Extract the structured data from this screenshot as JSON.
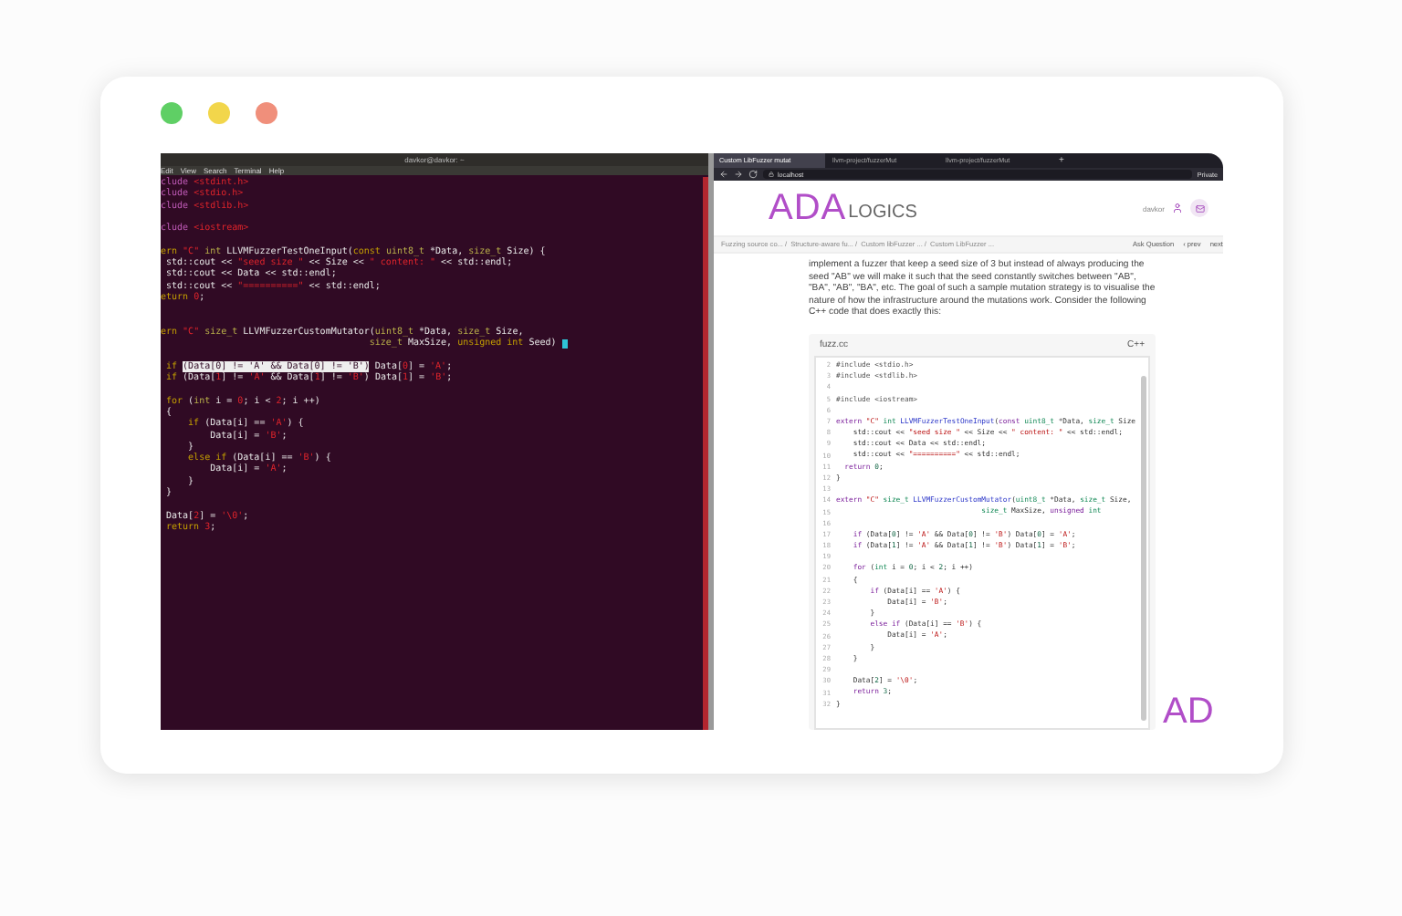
{
  "window_controls": [
    {
      "color": "#5fcf65"
    },
    {
      "color": "#f2d64b"
    },
    {
      "color": "#f08f7b"
    }
  ],
  "terminal": {
    "title": "davkor@davkor: ~",
    "menu": [
      "Edit",
      "View",
      "Search",
      "Terminal",
      "Help"
    ],
    "lines": [
      {
        "kind": "code",
        "segments": [
          {
            "text": "clude ",
            "kind": "preproc"
          },
          {
            "text": "<stdint.h>",
            "kind": "string"
          }
        ]
      },
      {
        "kind": "code",
        "segments": [
          {
            "text": "clude ",
            "kind": "preproc"
          },
          {
            "text": "<stdio.h>",
            "kind": "string"
          }
        ]
      },
      {
        "kind": "code",
        "segments": [
          {
            "text": "clude ",
            "kind": "preproc"
          },
          {
            "text": "<stdlib.h>",
            "kind": "string"
          }
        ]
      },
      {
        "kind": "blank"
      },
      {
        "kind": "code",
        "segments": [
          {
            "text": "clude ",
            "kind": "preproc"
          },
          {
            "text": "<iostream>",
            "kind": "string"
          }
        ]
      },
      {
        "kind": "blank"
      },
      {
        "kind": "code",
        "segments": [
          {
            "text": "ern ",
            "kind": "keyword"
          },
          {
            "text": "\"C\"",
            "kind": "string"
          },
          {
            "text": " int",
            "kind": "type"
          },
          {
            "text": " LLVMFuzzerTestOneInput(",
            "kind": "plain"
          },
          {
            "text": "const ",
            "kind": "keyword"
          },
          {
            "text": "uint8_t",
            "kind": "type"
          },
          {
            "text": " *Data, ",
            "kind": "plain"
          },
          {
            "text": "size_t",
            "kind": "type"
          },
          {
            "text": " Size) {",
            "kind": "plain"
          }
        ]
      },
      {
        "kind": "code",
        "segments": [
          {
            "text": " std::cout << ",
            "kind": "plain"
          },
          {
            "text": "\"seed size \"",
            "kind": "string"
          },
          {
            "text": " << Size << ",
            "kind": "plain"
          },
          {
            "text": "\" content: \"",
            "kind": "string"
          },
          {
            "text": " << std::endl;",
            "kind": "plain"
          }
        ]
      },
      {
        "kind": "code",
        "segments": [
          {
            "text": " std::cout << Data << std::endl;",
            "kind": "plain"
          }
        ]
      },
      {
        "kind": "code",
        "segments": [
          {
            "text": " std::cout << ",
            "kind": "plain"
          },
          {
            "text": "\"==========\"",
            "kind": "string"
          },
          {
            "text": " << std::endl;",
            "kind": "plain"
          }
        ]
      },
      {
        "kind": "code",
        "segments": [
          {
            "text": "eturn ",
            "kind": "keyword"
          },
          {
            "text": "0",
            "kind": "number"
          },
          {
            "text": ";",
            "kind": "plain"
          }
        ]
      },
      {
        "kind": "blank"
      },
      {
        "kind": "blank"
      },
      {
        "kind": "code",
        "segments": [
          {
            "text": "ern ",
            "kind": "keyword"
          },
          {
            "text": "\"C\"",
            "kind": "string"
          },
          {
            "text": " size_t",
            "kind": "type"
          },
          {
            "text": " LLVMFuzzerCustomMutator(",
            "kind": "plain"
          },
          {
            "text": "uint8_t",
            "kind": "type"
          },
          {
            "text": " *Data, ",
            "kind": "plain"
          },
          {
            "text": "size_t",
            "kind": "type"
          },
          {
            "text": " Size,",
            "kind": "plain"
          }
        ]
      },
      {
        "kind": "code",
        "cursor": true,
        "segments": [
          {
            "text": "                                      size_t",
            "kind": "type"
          },
          {
            "text": " MaxSize, ",
            "kind": "plain"
          },
          {
            "text": "unsigned int",
            "kind": "keyword"
          },
          {
            "text": " Seed) ",
            "kind": "plain"
          }
        ]
      },
      {
        "kind": "blank"
      },
      {
        "kind": "code",
        "segments": [
          {
            "text": " if ",
            "kind": "keyword"
          },
          {
            "text": "(Data[0] != 'A' && Data[0] != 'B')",
            "kind": "match"
          },
          {
            "text": " Data[",
            "kind": "plain"
          },
          {
            "text": "0",
            "kind": "number"
          },
          {
            "text": "] = ",
            "kind": "plain"
          },
          {
            "text": "'A'",
            "kind": "string"
          },
          {
            "text": ";",
            "kind": "plain"
          }
        ]
      },
      {
        "kind": "code",
        "segments": [
          {
            "text": " if",
            "kind": "keyword"
          },
          {
            "text": " (Data[",
            "kind": "plain"
          },
          {
            "text": "1",
            "kind": "number"
          },
          {
            "text": "] != ",
            "kind": "plain"
          },
          {
            "text": "'A'",
            "kind": "string"
          },
          {
            "text": " && Data[",
            "kind": "plain"
          },
          {
            "text": "1",
            "kind": "number"
          },
          {
            "text": "] != ",
            "kind": "plain"
          },
          {
            "text": "'B'",
            "kind": "string"
          },
          {
            "text": ") Data[",
            "kind": "plain"
          },
          {
            "text": "1",
            "kind": "number"
          },
          {
            "text": "] = ",
            "kind": "plain"
          },
          {
            "text": "'B'",
            "kind": "string"
          },
          {
            "text": ";",
            "kind": "plain"
          }
        ]
      },
      {
        "kind": "blank"
      },
      {
        "kind": "code",
        "segments": [
          {
            "text": " for",
            "kind": "keyword"
          },
          {
            "text": " (",
            "kind": "plain"
          },
          {
            "text": "int",
            "kind": "type"
          },
          {
            "text": " i = ",
            "kind": "plain"
          },
          {
            "text": "0",
            "kind": "number"
          },
          {
            "text": "; i < ",
            "kind": "plain"
          },
          {
            "text": "2",
            "kind": "number"
          },
          {
            "text": "; i ++)",
            "kind": "plain"
          }
        ]
      },
      {
        "kind": "code",
        "segments": [
          {
            "text": " {",
            "kind": "plain"
          }
        ]
      },
      {
        "kind": "code",
        "segments": [
          {
            "text": "     if",
            "kind": "keyword"
          },
          {
            "text": " (Data[i] == ",
            "kind": "plain"
          },
          {
            "text": "'A'",
            "kind": "string"
          },
          {
            "text": ") {",
            "kind": "plain"
          }
        ]
      },
      {
        "kind": "code",
        "segments": [
          {
            "text": "         Data[i] = ",
            "kind": "plain"
          },
          {
            "text": "'B'",
            "kind": "string"
          },
          {
            "text": ";",
            "kind": "plain"
          }
        ]
      },
      {
        "kind": "code",
        "segments": [
          {
            "text": "     }",
            "kind": "plain"
          }
        ]
      },
      {
        "kind": "code",
        "segments": [
          {
            "text": "     else if",
            "kind": "keyword"
          },
          {
            "text": " (Data[i] == ",
            "kind": "plain"
          },
          {
            "text": "'B'",
            "kind": "string"
          },
          {
            "text": ") {",
            "kind": "plain"
          }
        ]
      },
      {
        "kind": "code",
        "segments": [
          {
            "text": "         Data[i] = ",
            "kind": "plain"
          },
          {
            "text": "'A'",
            "kind": "string"
          },
          {
            "text": ";",
            "kind": "plain"
          }
        ]
      },
      {
        "kind": "code",
        "segments": [
          {
            "text": "     }",
            "kind": "plain"
          }
        ]
      },
      {
        "kind": "code",
        "segments": [
          {
            "text": " }",
            "kind": "plain"
          }
        ]
      },
      {
        "kind": "blank"
      },
      {
        "kind": "code",
        "segments": [
          {
            "text": " Data[",
            "kind": "plain"
          },
          {
            "text": "2",
            "kind": "number"
          },
          {
            "text": "] = ",
            "kind": "plain"
          },
          {
            "text": "'\\0'",
            "kind": "string"
          },
          {
            "text": ";",
            "kind": "plain"
          }
        ]
      },
      {
        "kind": "code",
        "segments": [
          {
            "text": " return ",
            "kind": "keyword"
          },
          {
            "text": "3",
            "kind": "number"
          },
          {
            "text": ";",
            "kind": "plain"
          }
        ]
      }
    ]
  },
  "browser": {
    "tabs": [
      {
        "label": "Custom LibFuzzer mutat",
        "selected": true
      },
      {
        "label": "llvm-project/fuzzerMut",
        "selected": false
      },
      {
        "label": "llvm-project/fuzzerMut",
        "selected": false
      }
    ],
    "new_tab": "+",
    "url": "localhost",
    "private_label": "Private",
    "logo": {
      "main": "ADA",
      "sub": "LOGICS"
    },
    "user": "davkor",
    "breadcrumbs": [
      "Fuzzing source co... /",
      "Structure-aware fu... /",
      "Custom libFuzzer ... /",
      "Custom LibFuzzer ..."
    ],
    "actions": [
      "Ask Question",
      "‹ prev",
      "next"
    ],
    "paragraph": "implement a fuzzer that keep a seed size of 3 but instead of always producing the seed \"AB\" we will make it such that the seed constantly switches between \"AB\", \"BA\", \"AB\", \"BA\", etc. The goal of such a sample mutation strategy is to visualise the nature of how the infrastructure around the mutations work. Consider the following C++ code that does exactly this:",
    "code": {
      "filename": "fuzz.cc",
      "language": "C++",
      "lines": [
        {
          "number": "2",
          "segments": [
            {
              "text": "#include ",
              "kind": "preproc"
            },
            {
              "text": "<stdio.h>",
              "kind": "preproc"
            }
          ]
        },
        {
          "number": "3",
          "segments": [
            {
              "text": "#include ",
              "kind": "preproc"
            },
            {
              "text": "<stdlib.h>",
              "kind": "preproc"
            }
          ]
        },
        {
          "number": "4"
        },
        {
          "number": "5",
          "segments": [
            {
              "text": "#include ",
              "kind": "preproc"
            },
            {
              "text": "<iostream>",
              "kind": "preproc"
            }
          ]
        },
        {
          "number": "6"
        },
        {
          "number": "7",
          "segments": [
            {
              "text": "extern ",
              "kind": "keyword"
            },
            {
              "text": "\"C\"",
              "kind": "string"
            },
            {
              "text": " int",
              "kind": "type"
            },
            {
              "text": " LLVMFuzzerTestOneInput",
              "kind": "func"
            },
            {
              "text": "(",
              "kind": "plain"
            },
            {
              "text": "const ",
              "kind": "keyword"
            },
            {
              "text": "uint8_t",
              "kind": "type"
            },
            {
              "text": " *Data, ",
              "kind": "plain"
            },
            {
              "text": "size_t",
              "kind": "type"
            },
            {
              "text": " Size",
              "kind": "plain"
            }
          ]
        },
        {
          "number": "8",
          "segments": [
            {
              "text": "    std::cout << ",
              "kind": "plain"
            },
            {
              "text": "\"seed size \"",
              "kind": "string"
            },
            {
              "text": " << Size << ",
              "kind": "plain"
            },
            {
              "text": "\" content: \"",
              "kind": "string"
            },
            {
              "text": " << std::endl;",
              "kind": "plain"
            }
          ]
        },
        {
          "number": "9",
          "segments": [
            {
              "text": "    std::cout << Data << std::endl;",
              "kind": "plain"
            }
          ]
        },
        {
          "number": "10",
          "segments": [
            {
              "text": "    std::cout << ",
              "kind": "plain"
            },
            {
              "text": "\"==========\"",
              "kind": "string"
            },
            {
              "text": " << std::endl;",
              "kind": "plain"
            }
          ]
        },
        {
          "number": "11",
          "segments": [
            {
              "text": "  return ",
              "kind": "keyword"
            },
            {
              "text": "0",
              "kind": "number"
            },
            {
              "text": ";",
              "kind": "plain"
            }
          ]
        },
        {
          "number": "12",
          "segments": [
            {
              "text": "}",
              "kind": "plain"
            }
          ]
        },
        {
          "number": "13"
        },
        {
          "number": "14",
          "segments": [
            {
              "text": "extern ",
              "kind": "keyword"
            },
            {
              "text": "\"C\"",
              "kind": "string"
            },
            {
              "text": " size_t",
              "kind": "type"
            },
            {
              "text": " LLVMFuzzerCustomMutator",
              "kind": "func"
            },
            {
              "text": "(",
              "kind": "plain"
            },
            {
              "text": "uint8_t",
              "kind": "type"
            },
            {
              "text": " *Data, ",
              "kind": "plain"
            },
            {
              "text": "size_t",
              "kind": "type"
            },
            {
              "text": " Size,",
              "kind": "plain"
            }
          ]
        },
        {
          "number": "15",
          "segments": [
            {
              "text": "                                  size_t",
              "kind": "type"
            },
            {
              "text": " MaxSize, ",
              "kind": "plain"
            },
            {
              "text": "unsigned",
              "kind": "keyword"
            },
            {
              "text": " int",
              "kind": "type"
            }
          ]
        },
        {
          "number": "16"
        },
        {
          "number": "17",
          "segments": [
            {
              "text": "    if",
              "kind": "keyword"
            },
            {
              "text": " (Data[",
              "kind": "plain"
            },
            {
              "text": "0",
              "kind": "number"
            },
            {
              "text": "] != ",
              "kind": "plain"
            },
            {
              "text": "'A'",
              "kind": "string"
            },
            {
              "text": " && Data[",
              "kind": "plain"
            },
            {
              "text": "0",
              "kind": "number"
            },
            {
              "text": "] != ",
              "kind": "plain"
            },
            {
              "text": "'B'",
              "kind": "string"
            },
            {
              "text": ") Data[",
              "kind": "plain"
            },
            {
              "text": "0",
              "kind": "number"
            },
            {
              "text": "] = ",
              "kind": "plain"
            },
            {
              "text": "'A'",
              "kind": "string"
            },
            {
              "text": ";",
              "kind": "plain"
            }
          ]
        },
        {
          "number": "18",
          "segments": [
            {
              "text": "    if",
              "kind": "keyword"
            },
            {
              "text": " (Data[",
              "kind": "plain"
            },
            {
              "text": "1",
              "kind": "number"
            },
            {
              "text": "] != ",
              "kind": "plain"
            },
            {
              "text": "'A'",
              "kind": "string"
            },
            {
              "text": " && Data[",
              "kind": "plain"
            },
            {
              "text": "1",
              "kind": "number"
            },
            {
              "text": "] != ",
              "kind": "plain"
            },
            {
              "text": "'B'",
              "kind": "string"
            },
            {
              "text": ") Data[",
              "kind": "plain"
            },
            {
              "text": "1",
              "kind": "number"
            },
            {
              "text": "] = ",
              "kind": "plain"
            },
            {
              "text": "'B'",
              "kind": "string"
            },
            {
              "text": ";",
              "kind": "plain"
            }
          ]
        },
        {
          "number": "19"
        },
        {
          "number": "20",
          "segments": [
            {
              "text": "    for",
              "kind": "keyword"
            },
            {
              "text": " (",
              "kind": "plain"
            },
            {
              "text": "int",
              "kind": "type"
            },
            {
              "text": " i = ",
              "kind": "plain"
            },
            {
              "text": "0",
              "kind": "number"
            },
            {
              "text": "; i < ",
              "kind": "plain"
            },
            {
              "text": "2",
              "kind": "number"
            },
            {
              "text": "; i ++)",
              "kind": "plain"
            }
          ]
        },
        {
          "number": "21",
          "segments": [
            {
              "text": "    {",
              "kind": "plain"
            }
          ]
        },
        {
          "number": "22",
          "segments": [
            {
              "text": "        if",
              "kind": "keyword"
            },
            {
              "text": " (Data[i] == ",
              "kind": "plain"
            },
            {
              "text": "'A'",
              "kind": "string"
            },
            {
              "text": ") {",
              "kind": "plain"
            }
          ]
        },
        {
          "number": "23",
          "segments": [
            {
              "text": "            Data[i] = ",
              "kind": "plain"
            },
            {
              "text": "'B'",
              "kind": "string"
            },
            {
              "text": ";",
              "kind": "plain"
            }
          ]
        },
        {
          "number": "24",
          "segments": [
            {
              "text": "        }",
              "kind": "plain"
            }
          ]
        },
        {
          "number": "25",
          "segments": [
            {
              "text": "        else if",
              "kind": "keyword"
            },
            {
              "text": " (Data[i] == ",
              "kind": "plain"
            },
            {
              "text": "'B'",
              "kind": "string"
            },
            {
              "text": ") {",
              "kind": "plain"
            }
          ]
        },
        {
          "number": "26",
          "segments": [
            {
              "text": "            Data[i] = ",
              "kind": "plain"
            },
            {
              "text": "'A'",
              "kind": "string"
            },
            {
              "text": ";",
              "kind": "plain"
            }
          ]
        },
        {
          "number": "27",
          "segments": [
            {
              "text": "        }",
              "kind": "plain"
            }
          ]
        },
        {
          "number": "28",
          "segments": [
            {
              "text": "    }",
              "kind": "plain"
            }
          ]
        },
        {
          "number": "29"
        },
        {
          "number": "30",
          "segments": [
            {
              "text": "    Data[",
              "kind": "plain"
            },
            {
              "text": "2",
              "kind": "number"
            },
            {
              "text": "] = ",
              "kind": "plain"
            },
            {
              "text": "'\\0'",
              "kind": "string"
            },
            {
              "text": ";",
              "kind": "plain"
            }
          ]
        },
        {
          "number": "31",
          "segments": [
            {
              "text": "    return ",
              "kind": "keyword"
            },
            {
              "text": "3",
              "kind": "number"
            },
            {
              "text": ";",
              "kind": "plain"
            }
          ]
        },
        {
          "number": "32",
          "segments": [
            {
              "text": "}",
              "kind": "plain"
            }
          ]
        }
      ]
    },
    "footer_logo": "AD"
  }
}
